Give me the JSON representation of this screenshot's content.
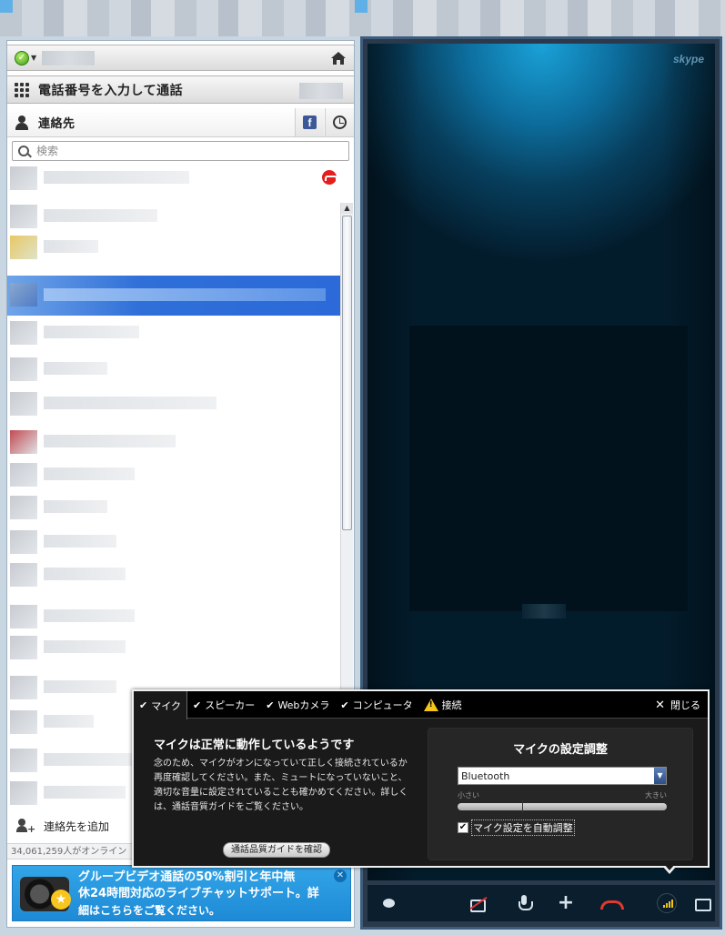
{
  "contacts_header": {
    "dial_label": "電話番号を入力して通話",
    "contacts_tab": "連絡先"
  },
  "search": {
    "placeholder": "検索"
  },
  "contact_list": {
    "add_contact": "連絡先を追加",
    "online_count": "34,061,259人がオンライン"
  },
  "ad": {
    "line1": "グループビデオ通話の50%割引と年中無",
    "line2": "休24時間対応のライブチャットサポート。詳",
    "line3": "細はこちらをご覧ください。"
  },
  "video": {
    "logo": "skype"
  },
  "quality_popup": {
    "tabs": [
      {
        "label": "マイク",
        "state": "ok"
      },
      {
        "label": "スピーカー",
        "state": "ok"
      },
      {
        "label": "Webカメラ",
        "state": "ok"
      },
      {
        "label": "コンピュータ",
        "state": "ok"
      },
      {
        "label": "接続",
        "state": "warning"
      }
    ],
    "close_label": "閉じる",
    "message_title": "マイクは正常に動作しているようです",
    "message_body": "念のため、マイクがオンになっていて正しく接続されているか再度確認してください。また、ミュートになっていないこと、適切な音量に設定されていることも確かめてください。詳しくは、通話音質ガイドをご覧ください。",
    "guide_button": "通話品質ガイドを確認",
    "settings_title": "マイクの設定調整",
    "device_selected": "Bluetooth",
    "volume_min_label": "小さい",
    "volume_max_label": "大きい",
    "volume_level": 0.31,
    "auto_adjust_label": "マイク設定を自動調整",
    "auto_adjust_checked": true
  },
  "colors": {
    "accent": "#2b6ad8",
    "warning": "#f5c518",
    "hangup": "#e03a2f",
    "ad_background": "#1e8ad6"
  }
}
